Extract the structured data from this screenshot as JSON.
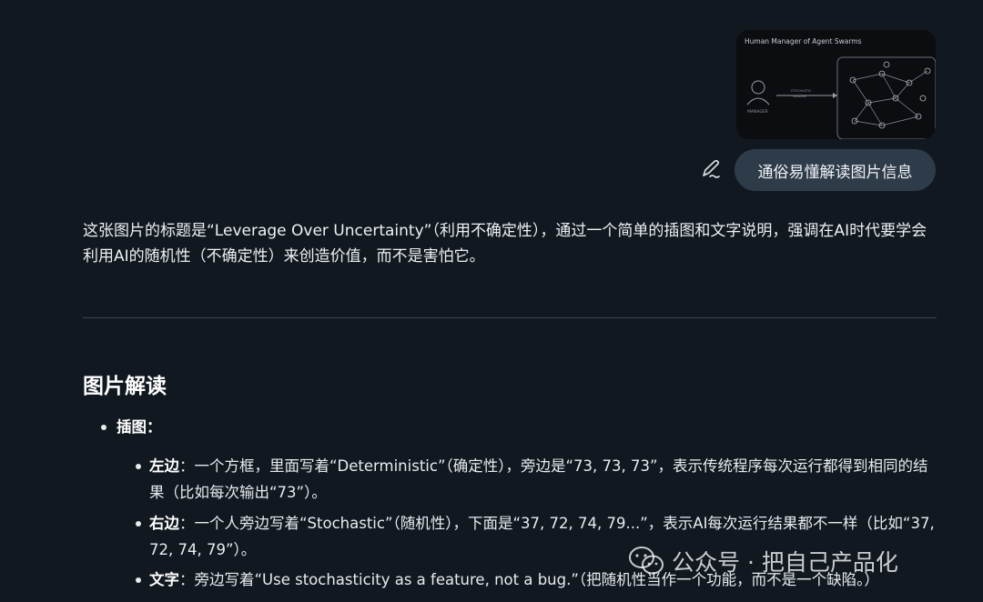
{
  "user_message": {
    "image_thumbnail": {
      "title": "Human Manager of Agent Swarms",
      "left_label": "MANAGER",
      "arrow_label_1": "STOCHASTIC",
      "arrow_label_2": "MINDSET"
    },
    "text": "通俗易懂解读图片信息",
    "edit_icon": "pencil-icon"
  },
  "assistant": {
    "intro": "这张图片的标题是“Leverage Over Uncertainty”（利用不确定性），通过一个简单的插图和文字说明，强调在AI时代要学会利用AI的随机性（不确定性）来创造价值，而不是害怕它。",
    "section_title": "图片解读",
    "list": {
      "label": "插图：",
      "items": [
        {
          "term": "左边",
          "sep": "：",
          "text": "一个方框，里面写着“Deterministic”（确定性），旁边是“73, 73, 73”，表示传统程序每次运行都得到相同的结果（比如每次输出“73”）。"
        },
        {
          "term": "右边",
          "sep": "：",
          "text": "一个人旁边写着“Stochastic”（随机性），下面是“37, 72, 74, 79...”，表示AI每次运行结果都不一样（比如“37, 72, 74, 79”）。"
        },
        {
          "term": "文字",
          "sep": "：",
          "text": "旁边写着“Use stochasticity as a feature, not a bug.”（把随机性当作一个功能，而不是一个缺陷。）"
        }
      ]
    }
  },
  "watermark": {
    "text": "公众号 · 把自己产品化",
    "icon": "wechat-icon"
  }
}
